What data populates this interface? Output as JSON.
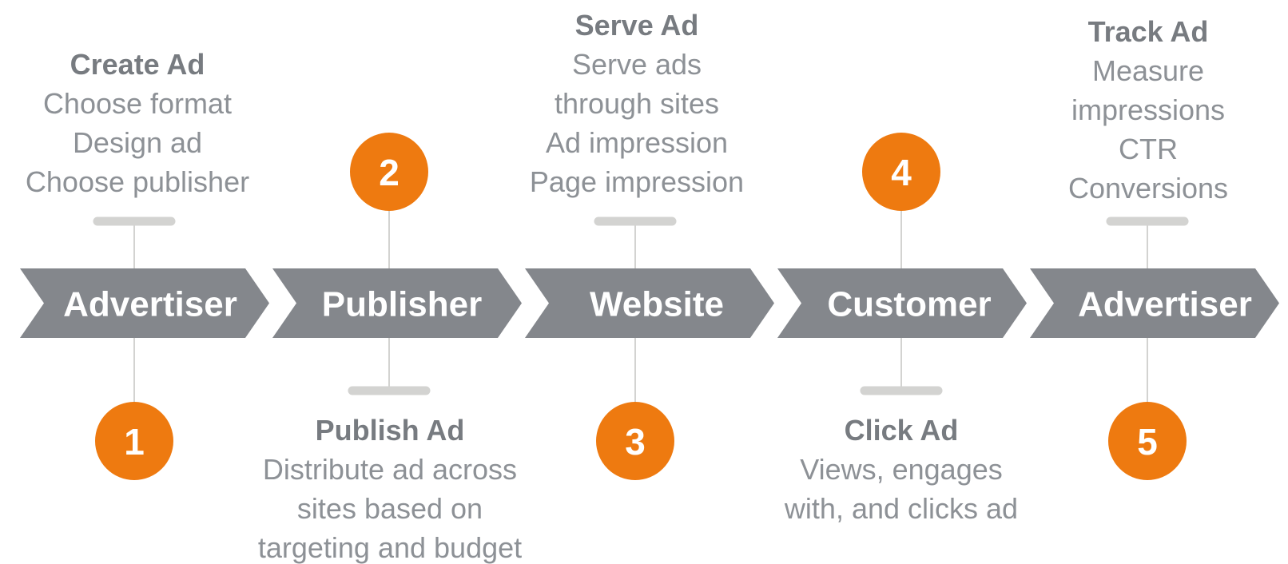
{
  "colors": {
    "chevron": "#84878c",
    "circle": "#ee7a10",
    "connector": "#d3d3d1",
    "title_text": "#777b80",
    "body_text": "#8d9196",
    "label_text": "#ffffff"
  },
  "stages": [
    {
      "label": "Advertiser"
    },
    {
      "label": "Publisher"
    },
    {
      "label": "Website"
    },
    {
      "label": "Customer"
    },
    {
      "label": "Advertiser"
    }
  ],
  "steps": [
    {
      "number": "1",
      "title": "Create Ad",
      "lines": [
        "Choose format",
        "Design ad",
        "Choose publisher"
      ],
      "icon": "numbered-circle-icon"
    },
    {
      "number": "2",
      "title": "Publish Ad",
      "lines": [
        "Distribute ad across",
        "sites based on",
        "targeting and budget"
      ],
      "icon": "numbered-circle-icon"
    },
    {
      "number": "3",
      "title": "Serve Ad",
      "lines": [
        "Serve ads",
        "through sites",
        "Ad impression",
        "Page impression"
      ],
      "icon": "numbered-circle-icon"
    },
    {
      "number": "4",
      "title": "Click Ad",
      "lines": [
        "Views, engages",
        "with, and clicks ad"
      ],
      "icon": "numbered-circle-icon"
    },
    {
      "number": "5",
      "title": "Track Ad",
      "lines": [
        "Measure",
        "impressions",
        "CTR",
        "Conversions"
      ],
      "icon": "numbered-circle-icon"
    }
  ]
}
